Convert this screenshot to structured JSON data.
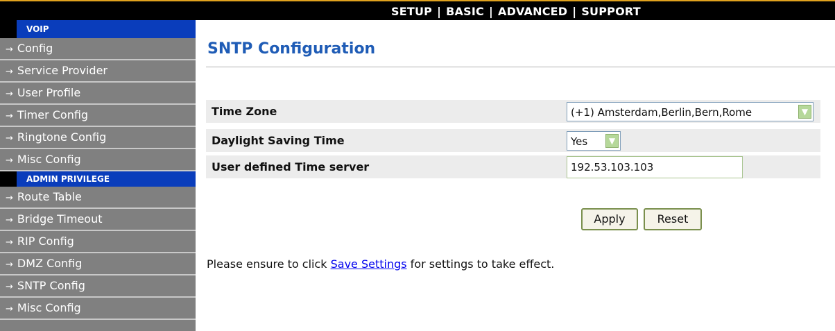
{
  "topnav": {
    "items": [
      "SETUP",
      "BASIC",
      "ADVANCED",
      "SUPPORT"
    ],
    "separator": "|"
  },
  "sidebar": {
    "voip_header": "VOIP",
    "voip_items": [
      "Config",
      "Service Provider",
      "User Profile",
      "Timer Config",
      "Ringtone Config",
      "Misc Config"
    ],
    "admin_header": "ADMIN PRIVILEGE",
    "admin_items": [
      "Route Table",
      "Bridge Timeout",
      "RIP Config",
      "DMZ Config",
      "SNTP Config",
      "Misc Config"
    ],
    "arrow_icon": "→"
  },
  "main": {
    "title": "SNTP Configuration",
    "fields": {
      "time_zone": {
        "label": "Time Zone",
        "value": "(+1) Amsterdam,Berlin,Bern,Rome"
      },
      "dst": {
        "label": "Daylight Saving Time",
        "value": "Yes"
      },
      "time_server": {
        "label": "User defined Time server",
        "value": "192.53.103.103"
      }
    },
    "buttons": {
      "apply": "Apply",
      "reset": "Reset"
    },
    "note": {
      "before": "Please ensure to click ",
      "link": "Save Settings",
      "after": " for settings to take effect."
    }
  },
  "colors": {
    "top_accent": "#e0a21e",
    "section_header": "#0a3dbb",
    "sidebar_bg": "#808080",
    "title": "#1f5cb6",
    "dropdown_arrow": "#b6d89a"
  },
  "icons": {
    "dropdown": "chevron-down-icon",
    "sidebar_arrow": "arrow-right-icon"
  }
}
